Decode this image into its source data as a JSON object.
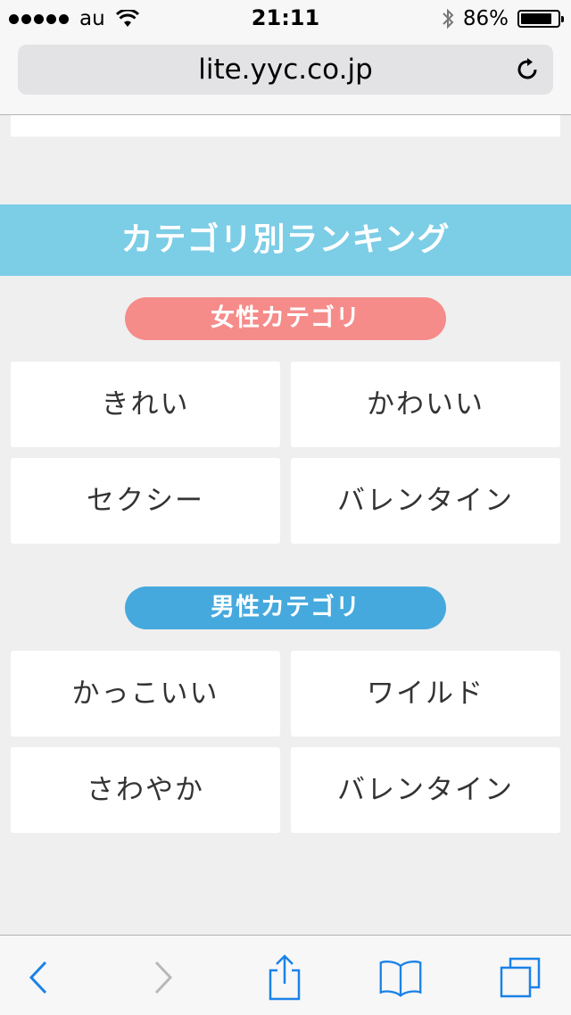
{
  "status_bar": {
    "carrier": "au",
    "time": "21:11",
    "battery_percent": "86%",
    "battery_level": 0.86
  },
  "browser": {
    "url": "lite.yyc.co.jp"
  },
  "ranking": {
    "title": "カテゴリ別ランキング",
    "female": {
      "label": "女性カテゴリ",
      "items": [
        "きれい",
        "かわいい",
        "セクシー",
        "バレンタイン"
      ]
    },
    "male": {
      "label": "男性カテゴリ",
      "items": [
        "かっこいい",
        "ワイルド",
        "さわやか",
        "バレンタイン"
      ]
    }
  },
  "colors": {
    "header": "#7ccde6",
    "female_pill": "#f58c8a",
    "male_pill": "#45a9dd",
    "toolbar_accent": "#1a82e8"
  },
  "toolbar_icons": [
    "back-icon",
    "forward-icon",
    "share-icon",
    "bookmarks-icon",
    "tabs-icon"
  ]
}
